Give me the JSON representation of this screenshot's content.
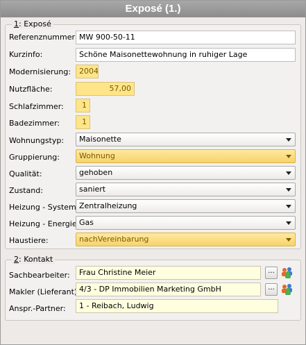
{
  "window": {
    "title": "Exposé (1.)"
  },
  "expose": {
    "group_number": "1",
    "group_title": ": Exposé",
    "referenznummer": {
      "label": "Referenznummer:",
      "value": "MW 900-50-11"
    },
    "kurzinfo": {
      "label": "Kurzinfo:",
      "value": "Schöne Maisonettewohnung in ruhiger Lage"
    },
    "modernisierung": {
      "label": "Modernisierung:",
      "value": "2004"
    },
    "nutzflaeche": {
      "label": "Nutzfläche:",
      "value": "57,00"
    },
    "schlafzimmer": {
      "label": "Schlafzimmer:",
      "value": "1"
    },
    "badezimmer": {
      "label": "Badezimmer:",
      "value": "1"
    },
    "wohnungstyp": {
      "label": "Wohnungstyp:",
      "value": "Maisonette"
    },
    "gruppierung": {
      "label": "Gruppierung:",
      "value": "Wohnung"
    },
    "qualitaet": {
      "label": "Qualität:",
      "value": "gehoben"
    },
    "zustand": {
      "label": "Zustand:",
      "value": "saniert"
    },
    "heizung_system": {
      "label": "Heizung - System:",
      "value": "Zentralheizung"
    },
    "heizung_energie": {
      "label": "Heizung - Energie:",
      "value": "Gas"
    },
    "haustiere": {
      "label": "Haustiere:",
      "value": "nachVereinbarung"
    }
  },
  "kontakt": {
    "group_number": "2",
    "group_title": ": Kontakt",
    "sachbearbeiter": {
      "label": "Sachbearbeiter:",
      "value": "Frau Christine Meier",
      "button": "..."
    },
    "makler": {
      "label": "Makler (Lieferant):",
      "value": "4/3 - DP Immobilien Marketing GmbH",
      "button": "..."
    },
    "ansprechpartner": {
      "label": "Anspr.-Partner:",
      "value": "1 - Reibach, Ludwig"
    }
  }
}
